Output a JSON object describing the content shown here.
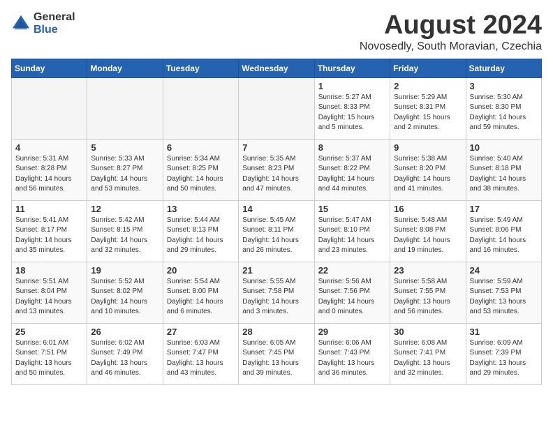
{
  "header": {
    "logo_general": "General",
    "logo_blue": "Blue",
    "month_year": "August 2024",
    "location": "Novosedly, South Moravian, Czechia"
  },
  "weekdays": [
    "Sunday",
    "Monday",
    "Tuesday",
    "Wednesday",
    "Thursday",
    "Friday",
    "Saturday"
  ],
  "weeks": [
    [
      {
        "day": "",
        "info": ""
      },
      {
        "day": "",
        "info": ""
      },
      {
        "day": "",
        "info": ""
      },
      {
        "day": "",
        "info": ""
      },
      {
        "day": "1",
        "info": "Sunrise: 5:27 AM\nSunset: 8:33 PM\nDaylight: 15 hours\nand 5 minutes."
      },
      {
        "day": "2",
        "info": "Sunrise: 5:29 AM\nSunset: 8:31 PM\nDaylight: 15 hours\nand 2 minutes."
      },
      {
        "day": "3",
        "info": "Sunrise: 5:30 AM\nSunset: 8:30 PM\nDaylight: 14 hours\nand 59 minutes."
      }
    ],
    [
      {
        "day": "4",
        "info": "Sunrise: 5:31 AM\nSunset: 8:28 PM\nDaylight: 14 hours\nand 56 minutes."
      },
      {
        "day": "5",
        "info": "Sunrise: 5:33 AM\nSunset: 8:27 PM\nDaylight: 14 hours\nand 53 minutes."
      },
      {
        "day": "6",
        "info": "Sunrise: 5:34 AM\nSunset: 8:25 PM\nDaylight: 14 hours\nand 50 minutes."
      },
      {
        "day": "7",
        "info": "Sunrise: 5:35 AM\nSunset: 8:23 PM\nDaylight: 14 hours\nand 47 minutes."
      },
      {
        "day": "8",
        "info": "Sunrise: 5:37 AM\nSunset: 8:22 PM\nDaylight: 14 hours\nand 44 minutes."
      },
      {
        "day": "9",
        "info": "Sunrise: 5:38 AM\nSunset: 8:20 PM\nDaylight: 14 hours\nand 41 minutes."
      },
      {
        "day": "10",
        "info": "Sunrise: 5:40 AM\nSunset: 8:18 PM\nDaylight: 14 hours\nand 38 minutes."
      }
    ],
    [
      {
        "day": "11",
        "info": "Sunrise: 5:41 AM\nSunset: 8:17 PM\nDaylight: 14 hours\nand 35 minutes."
      },
      {
        "day": "12",
        "info": "Sunrise: 5:42 AM\nSunset: 8:15 PM\nDaylight: 14 hours\nand 32 minutes."
      },
      {
        "day": "13",
        "info": "Sunrise: 5:44 AM\nSunset: 8:13 PM\nDaylight: 14 hours\nand 29 minutes."
      },
      {
        "day": "14",
        "info": "Sunrise: 5:45 AM\nSunset: 8:11 PM\nDaylight: 14 hours\nand 26 minutes."
      },
      {
        "day": "15",
        "info": "Sunrise: 5:47 AM\nSunset: 8:10 PM\nDaylight: 14 hours\nand 23 minutes."
      },
      {
        "day": "16",
        "info": "Sunrise: 5:48 AM\nSunset: 8:08 PM\nDaylight: 14 hours\nand 19 minutes."
      },
      {
        "day": "17",
        "info": "Sunrise: 5:49 AM\nSunset: 8:06 PM\nDaylight: 14 hours\nand 16 minutes."
      }
    ],
    [
      {
        "day": "18",
        "info": "Sunrise: 5:51 AM\nSunset: 8:04 PM\nDaylight: 14 hours\nand 13 minutes."
      },
      {
        "day": "19",
        "info": "Sunrise: 5:52 AM\nSunset: 8:02 PM\nDaylight: 14 hours\nand 10 minutes."
      },
      {
        "day": "20",
        "info": "Sunrise: 5:54 AM\nSunset: 8:00 PM\nDaylight: 14 hours\nand 6 minutes."
      },
      {
        "day": "21",
        "info": "Sunrise: 5:55 AM\nSunset: 7:58 PM\nDaylight: 14 hours\nand 3 minutes."
      },
      {
        "day": "22",
        "info": "Sunrise: 5:56 AM\nSunset: 7:56 PM\nDaylight: 14 hours\nand 0 minutes."
      },
      {
        "day": "23",
        "info": "Sunrise: 5:58 AM\nSunset: 7:55 PM\nDaylight: 13 hours\nand 56 minutes."
      },
      {
        "day": "24",
        "info": "Sunrise: 5:59 AM\nSunset: 7:53 PM\nDaylight: 13 hours\nand 53 minutes."
      }
    ],
    [
      {
        "day": "25",
        "info": "Sunrise: 6:01 AM\nSunset: 7:51 PM\nDaylight: 13 hours\nand 50 minutes."
      },
      {
        "day": "26",
        "info": "Sunrise: 6:02 AM\nSunset: 7:49 PM\nDaylight: 13 hours\nand 46 minutes."
      },
      {
        "day": "27",
        "info": "Sunrise: 6:03 AM\nSunset: 7:47 PM\nDaylight: 13 hours\nand 43 minutes."
      },
      {
        "day": "28",
        "info": "Sunrise: 6:05 AM\nSunset: 7:45 PM\nDaylight: 13 hours\nand 39 minutes."
      },
      {
        "day": "29",
        "info": "Sunrise: 6:06 AM\nSunset: 7:43 PM\nDaylight: 13 hours\nand 36 minutes."
      },
      {
        "day": "30",
        "info": "Sunrise: 6:08 AM\nSunset: 7:41 PM\nDaylight: 13 hours\nand 32 minutes."
      },
      {
        "day": "31",
        "info": "Sunrise: 6:09 AM\nSunset: 7:39 PM\nDaylight: 13 hours\nand 29 minutes."
      }
    ]
  ]
}
